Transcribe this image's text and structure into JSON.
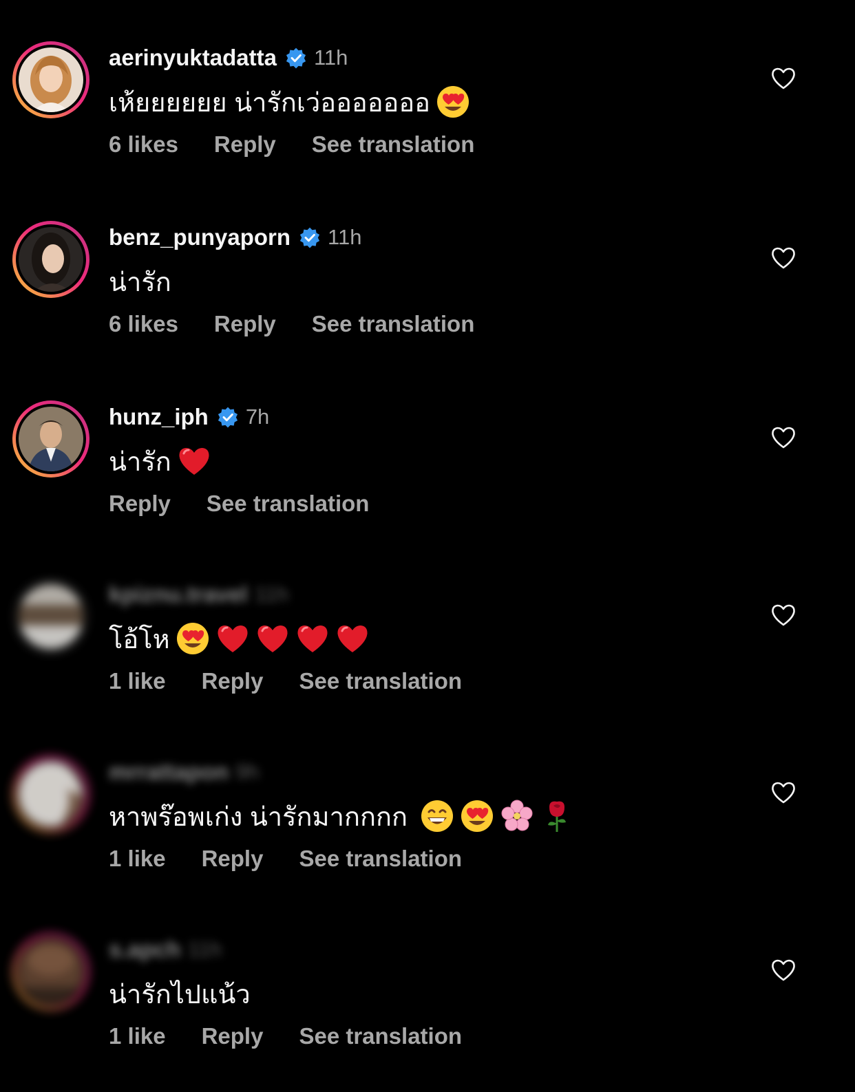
{
  "theme": {
    "background": "#000000",
    "text_primary": "#f5f5f5",
    "text_secondary": "#a8a8a8",
    "verified_blue": "#3897f0",
    "story_ring_gradient": [
      "#f9ce34",
      "#ee2a7b",
      "#c13584"
    ]
  },
  "comments": [
    {
      "username": "aerinyuktadatta",
      "verified": true,
      "time": "11h",
      "text": "เห้ยยยยยย น่ารักเว่อออออออ",
      "emojis": [
        "heart-eyes-emoji"
      ],
      "likes": "6 likes",
      "reply": "Reply",
      "translate": "See translation",
      "avatar_icon": "avatar-photo"
    },
    {
      "username": "benz_punyaporn",
      "verified": true,
      "time": "11h",
      "text": "น่ารัก",
      "emojis": [],
      "likes": "6 likes",
      "reply": "Reply",
      "translate": "See translation",
      "avatar_icon": "avatar-photo"
    },
    {
      "username": "hunz_iph",
      "verified": true,
      "time": "7h",
      "text": "น่ารัก",
      "emojis": [
        "red-heart-emoji"
      ],
      "likes": "",
      "reply": "Reply",
      "translate": "See translation",
      "avatar_icon": "avatar-photo"
    },
    {
      "username": "kpiznu.travel",
      "verified": false,
      "time": "11h",
      "text": "โอ้โห",
      "emojis": [
        "heart-eyes-emoji",
        "red-heart-emoji",
        "red-heart-emoji",
        "red-heart-emoji",
        "red-heart-emoji"
      ],
      "likes": "1 like",
      "reply": "Reply",
      "translate": "See translation",
      "avatar_icon": "avatar-photo-blurred"
    },
    {
      "username": "mrrattapon",
      "verified": false,
      "time": "9h",
      "text": "หาพร๊อพเก่ง น่ารักมากกกก",
      "emojis": [
        "grinning-emoji",
        "heart-eyes-emoji",
        "cherry-blossom-emoji",
        "rose-emoji"
      ],
      "likes": "1 like",
      "reply": "Reply",
      "translate": "See translation",
      "avatar_icon": "avatar-photo-blurred"
    },
    {
      "username": "s.apch",
      "verified": false,
      "time": "11h",
      "text": "น่ารักไปแน้ว",
      "emojis": [],
      "likes": "1 like",
      "reply": "Reply",
      "translate": "See translation",
      "avatar_icon": "avatar-photo-blurred"
    }
  ]
}
